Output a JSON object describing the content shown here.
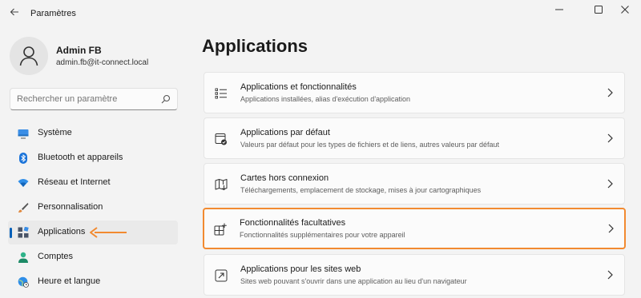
{
  "window": {
    "title": "Paramètres",
    "back_icon": "arrow-left-icon",
    "minimize_icon": "minimize-icon",
    "maximize_icon": "maximize-icon",
    "close_icon": "close-icon"
  },
  "profile": {
    "name": "Admin FB",
    "email": "admin.fb@it-connect.local",
    "avatar_icon": "person-icon"
  },
  "search": {
    "placeholder": "Rechercher un paramètre",
    "icon": "search-icon"
  },
  "sidebar": {
    "items": [
      {
        "label": "Système",
        "icon": "monitor-icon",
        "active": false
      },
      {
        "label": "Bluetooth et appareils",
        "icon": "bluetooth-icon",
        "active": false
      },
      {
        "label": "Réseau et Internet",
        "icon": "wifi-icon",
        "active": false
      },
      {
        "label": "Personnalisation",
        "icon": "brush-icon",
        "active": false
      },
      {
        "label": "Applications",
        "icon": "apps-icon",
        "active": true
      },
      {
        "label": "Comptes",
        "icon": "person-icon",
        "active": false
      },
      {
        "label": "Heure et langue",
        "icon": "globe-clock-icon",
        "active": false
      }
    ]
  },
  "main": {
    "title": "Applications",
    "cards": [
      {
        "title": "Applications et fonctionnalités",
        "subtitle": "Applications installées, alias d'exécution d'application",
        "icon": "list-icon",
        "highlighted": false
      },
      {
        "title": "Applications par défaut",
        "subtitle": "Valeurs par défaut pour les types de fichiers et de liens, autres valeurs par défaut",
        "icon": "default-apps-icon",
        "highlighted": false
      },
      {
        "title": "Cartes hors connexion",
        "subtitle": "Téléchargements, emplacement de stockage, mises à jour cartographiques",
        "icon": "map-icon",
        "highlighted": false
      },
      {
        "title": "Fonctionnalités facultatives",
        "subtitle": "Fonctionnalités supplémentaires pour votre appareil",
        "icon": "add-grid-icon",
        "highlighted": true
      },
      {
        "title": "Applications pour les sites web",
        "subtitle": "Sites web pouvant s'ouvrir dans une application au lieu d'un navigateur",
        "icon": "open-external-icon",
        "highlighted": false
      }
    ]
  },
  "colors": {
    "accent": "#005fb8",
    "highlight": "#f28a30",
    "background": "#f3f3f3",
    "card": "#fbfbfb"
  }
}
